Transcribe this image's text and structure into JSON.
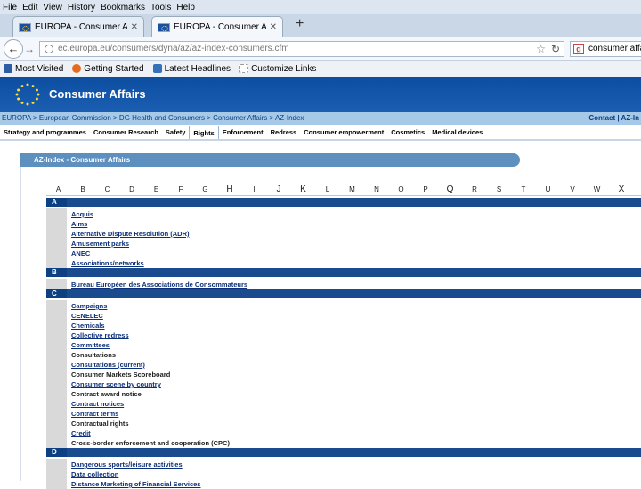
{
  "menu": [
    "File",
    "Edit",
    "View",
    "History",
    "Bookmarks",
    "Tools",
    "Help"
  ],
  "tabs": [
    {
      "title": "EUROPA - Consumer Affairs"
    },
    {
      "title": "EUROPA - Consumer Affair..."
    }
  ],
  "address": {
    "url": "ec.europa.eu/consumers/dyna/az/az-index-consumers.cfm"
  },
  "search": {
    "engine_icon": "google-icon",
    "value": "consumer affa"
  },
  "bookmarks": [
    {
      "label": "Most Visited",
      "icon": "bookmark-icon",
      "color": "#2d5ea5"
    },
    {
      "label": "Getting Started",
      "icon": "firefox-icon",
      "color": "#e66a1b"
    },
    {
      "label": "Latest Headlines",
      "icon": "rss-icon",
      "color": "#3570b8"
    },
    {
      "label": "Customize Links",
      "icon": "page-icon",
      "color": "#b0b0b0"
    }
  ],
  "site": {
    "title": "Consumer Affairs"
  },
  "breadcrumb": {
    "text": "EUROPA > European Commission > DG Health and Consumers > Consumer Affairs > AZ-Index",
    "contact": "Contact | AZ-In"
  },
  "main_nav": [
    "Strategy and programmes",
    "Consumer Research",
    "Safety",
    "Rights",
    "Enforcement",
    "Redress",
    "Consumer empowerment",
    "Cosmetics",
    "Medical devices"
  ],
  "main_nav_selected": "Rights",
  "az_title": "AZ-Index - Consumer Affairs",
  "letters": [
    "A",
    "B",
    "C",
    "D",
    "E",
    "F",
    "G",
    "H",
    "I",
    "J",
    "K",
    "L",
    "M",
    "N",
    "O",
    "P",
    "Q",
    "R",
    "S",
    "T",
    "U",
    "V",
    "W",
    "X"
  ],
  "sections": [
    {
      "letter": "A",
      "entries": [
        "Acquis",
        "Aims",
        "Alternative Dispute Resolution (ADR)",
        "Amusement parks",
        "ANEC",
        "Associations/networks"
      ]
    },
    {
      "letter": "B",
      "entries": [
        "Bureau Européen des Associations de Consommateurs"
      ]
    },
    {
      "letter": "C",
      "entries": [
        "Campaigns",
        "CENELEC",
        "Chemicals",
        "Collective redress",
        "Committees",
        "Consultations",
        "Consultations (current)",
        "Consumer Markets Scoreboard",
        "Consumer scene by country",
        "Contract award notice",
        "Contract notices",
        "Contract terms",
        "Contractual rights",
        "Credit",
        "Cross-border enforcement and cooperation (CPC)"
      ]
    },
    {
      "letter": "D",
      "entries": [
        "Dangerous sports/leisure activities",
        "Data collection",
        "Distance Marketing of Financial Services"
      ]
    }
  ]
}
